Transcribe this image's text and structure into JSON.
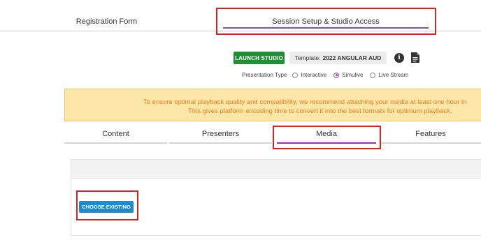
{
  "top_tabs": [
    {
      "label": "Registration Form"
    },
    {
      "label": "Session Setup & Studio Access"
    }
  ],
  "toolbar": {
    "launch_label": "LAUNCH STUDIO",
    "template_prefix": "Template:",
    "template_name": "2022 ANGULAR AUD",
    "info_icon": "info-icon",
    "doc_icon": "document-icon"
  },
  "presentation_type": {
    "label": "Presentation Type",
    "options": [
      "Interactive",
      "Simulive",
      "Live Stream"
    ],
    "selected": "Simulive"
  },
  "notice": {
    "line1": "To ensure optimal playback quality and compatibility, we recommend attaching your media at least one hour in",
    "line2": "This gives platform encoding time to convert it into the best formats for optimum playback."
  },
  "sub_tabs": [
    {
      "label": "Content"
    },
    {
      "label": "Presenters"
    },
    {
      "label": "Media"
    },
    {
      "label": "Features"
    }
  ],
  "active_sub_tab": "Media",
  "media": {
    "choose_label": "CHOOSE EXISTING"
  },
  "colors": {
    "launch_green": "#1f8f36",
    "accent_purple": "#9a2fb8",
    "choose_blue": "#1b8ccf",
    "notice_bg": "#fce7a8",
    "notice_text": "#f07a1a",
    "highlight_red": "#e01f1f"
  }
}
